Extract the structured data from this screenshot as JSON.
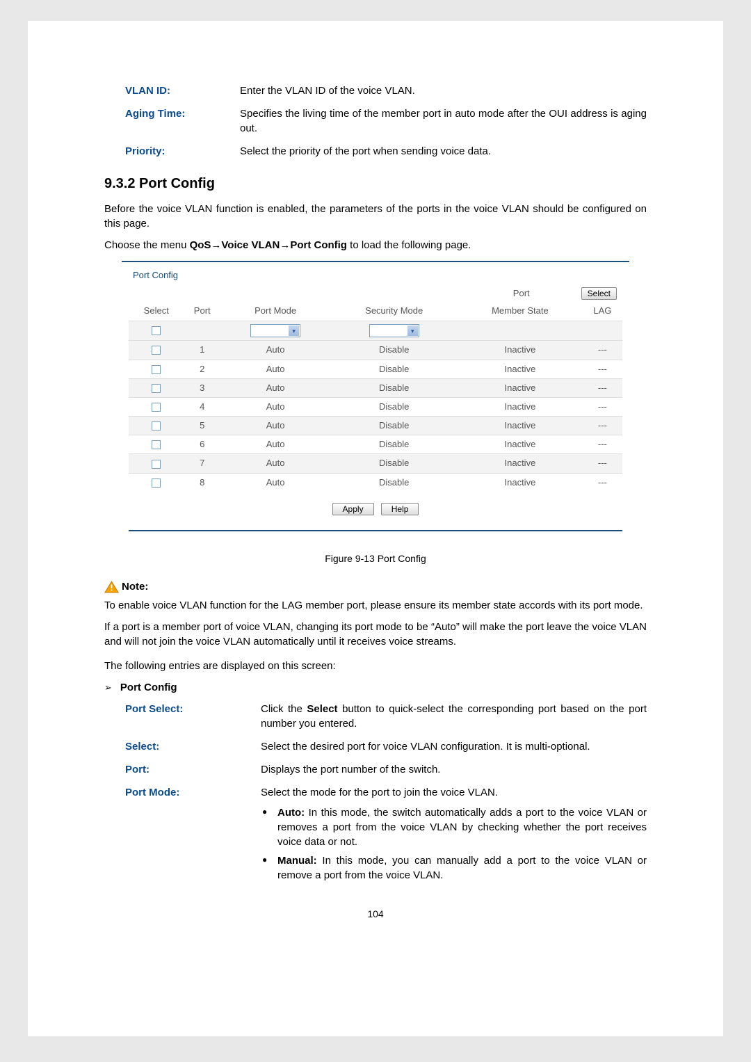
{
  "defs": {
    "vlan_id": {
      "label": "VLAN ID:",
      "val": "Enter the VLAN ID of the voice VLAN."
    },
    "aging_time": {
      "label": "Aging Time:",
      "val": "Specifies the living time of the member port in auto mode after the OUI address is aging out."
    },
    "priority": {
      "label": "Priority:",
      "val": "Select the priority of the port when sending voice data."
    }
  },
  "section": {
    "number_title": "9.3.2 Port Config",
    "intro": "Before the voice VLAN function is enabled, the parameters of the ports in the voice VLAN should be configured on this page.",
    "menu_pre": "Choose the menu ",
    "menu_bold": "QoS→Voice VLAN→Port Config",
    "menu_post": " to load the following page."
  },
  "panel": {
    "title": "Port Config",
    "port_label": "Port",
    "select_btn": "Select",
    "headers": {
      "select": "Select",
      "port": "Port",
      "port_mode": "Port Mode",
      "security_mode": "Security Mode",
      "member_state": "Member State",
      "lag": "LAG"
    },
    "rows": [
      {
        "port": "1",
        "mode": "Auto",
        "sec": "Disable",
        "state": "Inactive",
        "lag": "---"
      },
      {
        "port": "2",
        "mode": "Auto",
        "sec": "Disable",
        "state": "Inactive",
        "lag": "---"
      },
      {
        "port": "3",
        "mode": "Auto",
        "sec": "Disable",
        "state": "Inactive",
        "lag": "---"
      },
      {
        "port": "4",
        "mode": "Auto",
        "sec": "Disable",
        "state": "Inactive",
        "lag": "---"
      },
      {
        "port": "5",
        "mode": "Auto",
        "sec": "Disable",
        "state": "Inactive",
        "lag": "---"
      },
      {
        "port": "6",
        "mode": "Auto",
        "sec": "Disable",
        "state": "Inactive",
        "lag": "---"
      },
      {
        "port": "7",
        "mode": "Auto",
        "sec": "Disable",
        "state": "Inactive",
        "lag": "---"
      },
      {
        "port": "8",
        "mode": "Auto",
        "sec": "Disable",
        "state": "Inactive",
        "lag": "---"
      }
    ],
    "apply_btn": "Apply",
    "help_btn": "Help"
  },
  "figure_caption": "Figure 9-13 Port Config",
  "note": {
    "heading": "Note:",
    "p1": "To enable voice VLAN function for the LAG member port, please ensure its member state accords with its port mode.",
    "p2": "If a port is a member port of voice VLAN, changing its port mode to be “Auto” will make the port leave the voice VLAN and will not join the voice VLAN automatically until it receives voice streams."
  },
  "entries_intro": "The following entries are displayed on this screen:",
  "pc_heading": "Port Config",
  "pc": {
    "port_select": {
      "label": "Port Select:",
      "pre": "Click the ",
      "bold": "Select",
      "post": " button to quick-select the corresponding port based on the port number you entered."
    },
    "select": {
      "label": "Select:",
      "val": "Select the desired port for voice VLAN configuration. It is multi-optional."
    },
    "port": {
      "label": "Port:",
      "val": "Displays the port number of the switch."
    },
    "port_mode": {
      "label": "Port Mode:",
      "intro": "Select the mode for the port to join the voice VLAN.",
      "auto_b": "Auto:",
      "auto_t": " In this mode, the switch automatically adds a port to the voice VLAN or removes a port from the voice VLAN by checking whether the port receives voice data or not.",
      "manual_b": "Manual:",
      "manual_t": " In this mode, you can manually add a port to the voice VLAN or remove a port from the voice VLAN."
    }
  },
  "page_number": "104"
}
